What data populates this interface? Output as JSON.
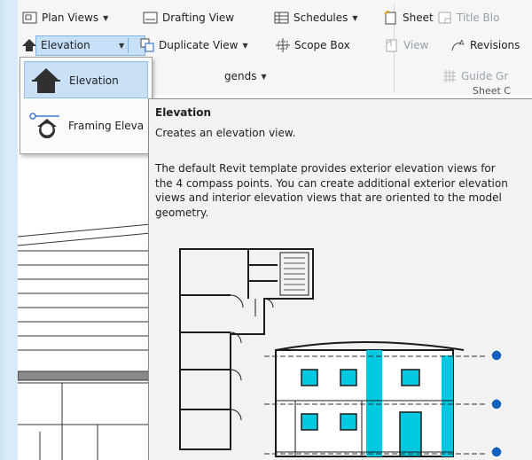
{
  "ribbon": {
    "row1": {
      "plan_views": "Plan Views",
      "drafting_view": "Drafting View",
      "schedules": "Schedules",
      "sheet": "Sheet",
      "title_block": "Title Blo"
    },
    "row2": {
      "elevation": "Elevation",
      "duplicate_view": "Duplicate View",
      "scope_box": "Scope Box",
      "view": "View",
      "revisions": "Revisions"
    },
    "row3": {
      "legends": "gends",
      "guide_grid": "Guide Gr"
    },
    "panel_label": "Sheet C"
  },
  "dropdown": {
    "items": [
      {
        "label": "Elevation",
        "icon": "elevation-icon"
      },
      {
        "label": "Framing Eleva",
        "icon": "framing-elevation-icon"
      }
    ]
  },
  "tooltip": {
    "title": "Elevation",
    "description": "Creates an elevation view.",
    "body": "The default Revit template provides exterior elevation views for the 4 compass points. You can create additional exterior elevation views and interior elevation views that are oriented to the model geometry.",
    "image_label": "floor-plan-and-elevation-illustration"
  },
  "colors": {
    "highlight": "#c9e0f7",
    "highlight_border": "#8ec0ef",
    "ribbon_bg": "#f5f6f7",
    "window_accent": "#00c8e0",
    "elevation_marker": "#1560c0"
  }
}
